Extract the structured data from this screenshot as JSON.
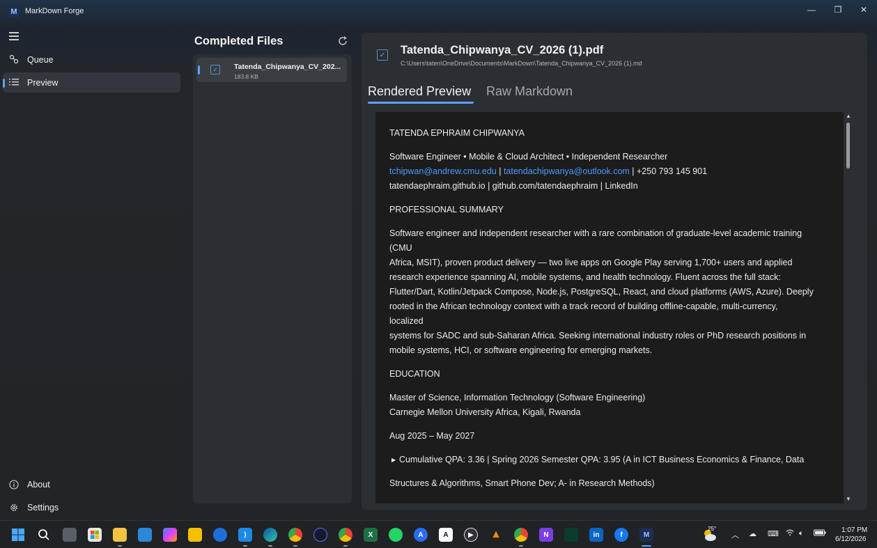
{
  "window": {
    "title": "MarkDown Forge",
    "minimize_glyph": "—",
    "maximize_glyph": "❐",
    "close_glyph": "✕"
  },
  "nav": {
    "items": [
      {
        "label": "Queue",
        "icon": "queue-icon",
        "active": false
      },
      {
        "label": "Preview",
        "icon": "list-icon",
        "active": true
      }
    ],
    "bottom": [
      {
        "label": "About",
        "icon": "info-icon"
      },
      {
        "label": "Settings",
        "icon": "gear-icon"
      }
    ]
  },
  "files_panel": {
    "title": "Completed Files",
    "items": [
      {
        "name": "Tatenda_Chipwanya_CV_202...",
        "size": "183.8 KB"
      }
    ]
  },
  "preview": {
    "doc_title": "Tatenda_Chipwanya_CV_2026 (1).pdf",
    "doc_path": "C:\\Users\\taten\\OneDrive\\Documents\\MarkDown\\Tatenda_Chipwanya_CV_2026 (1).md",
    "tabs": [
      {
        "label": "Rendered Preview",
        "active": true
      },
      {
        "label": "Raw Markdown",
        "active": false
      }
    ],
    "content": {
      "name": "TATENDA EPHRAIM CHIPWANYA",
      "tagline": "Software Engineer • Mobile & Cloud Architect • Independent Researcher",
      "email1": "tchipwan@andrew.cmu.edu",
      "sep1": " | ",
      "email2": "tatendachipwanya@outlook.com",
      "phone": " | +250 793 145 901",
      "links": "tatendaephraim.github.io | github.com/tatendaephraim | LinkedIn",
      "summary_heading": "PROFESSIONAL SUMMARY",
      "summary_lines": [
        "Software engineer and independent researcher with a rare combination of graduate-level academic training",
        "(CMU",
        "Africa, MSIT), proven product delivery — two live apps on Google Play serving 1,700+ users and applied",
        "research experience spanning AI, mobile systems, and health technology. Fluent across the full stack:",
        "Flutter/Dart, Kotlin/Jetpack Compose, Node.js, PostgreSQL, React, and cloud platforms (AWS, Azure). Deeply",
        "rooted in the African technology context with a track record of building offline-capable, multi-currency,",
        "localized",
        "systems for SADC and sub-Saharan Africa. Seeking international industry roles or PhD research positions in",
        "mobile systems, HCI, or software engineering for emerging markets."
      ],
      "education_heading": "EDUCATION",
      "degree": "Master of Science, Information Technology (Software Engineering)",
      "university": "Carnegie Mellon University Africa, Kigali, Rwanda",
      "dates": "Aug 2025 – May 2027",
      "bullet": "Cumulative QPA: 3.36 | Spring 2026 Semester QPA: 3.95 (A in ICT Business Economics & Finance, Data",
      "bullet_cont": "Structures & Algorithms, Smart Phone Dev; A- in Research Methods)"
    }
  },
  "taskbar": {
    "temperature": "25°",
    "time": "1:07 PM",
    "date": "6/12/2026",
    "accent": "#5aa2ff"
  }
}
